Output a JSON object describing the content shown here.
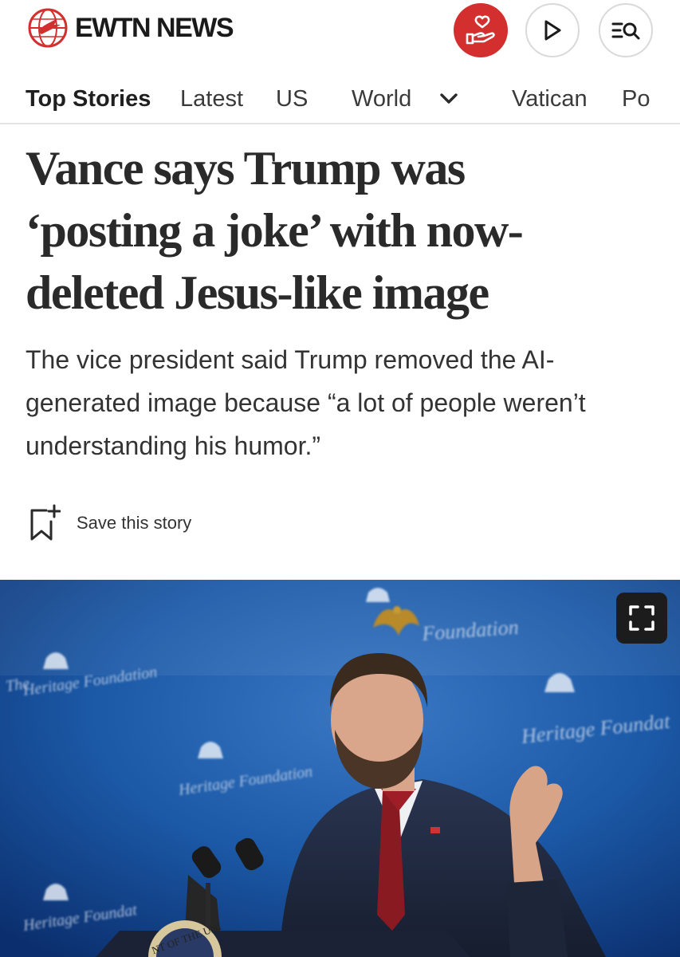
{
  "brand": {
    "name": "EWTN NEWS",
    "accent": "#d32f2f"
  },
  "header": {
    "icons": [
      "donate-heart-hand-icon",
      "play-icon",
      "search-menu-icon"
    ]
  },
  "nav": {
    "items": [
      {
        "label": "Top Stories",
        "active": true
      },
      {
        "label": "Latest",
        "active": false
      },
      {
        "label": "US",
        "active": false
      },
      {
        "label": "World",
        "active": false
      },
      {
        "label": "Vatican",
        "active": false
      },
      {
        "label": "Po",
        "active": false
      }
    ]
  },
  "article": {
    "headline_lines": [
      "Vance says Trump was",
      "‘posting a joke’ with now-",
      "deleted Jesus-like image"
    ],
    "subhead_lines": [
      "The vice president said Trump removed the AI-",
      "generated image because “a lot of people weren’t",
      "understanding his humor.”"
    ],
    "save_label": "Save this story"
  },
  "photo": {
    "backdrop_signs": [
      "The",
      "Heritage Foundation",
      "Foundation",
      "Heritage Foundat",
      "Heritage Foundation",
      "Heritage Foundat"
    ],
    "seal_text": "NT OF THE UNI"
  }
}
